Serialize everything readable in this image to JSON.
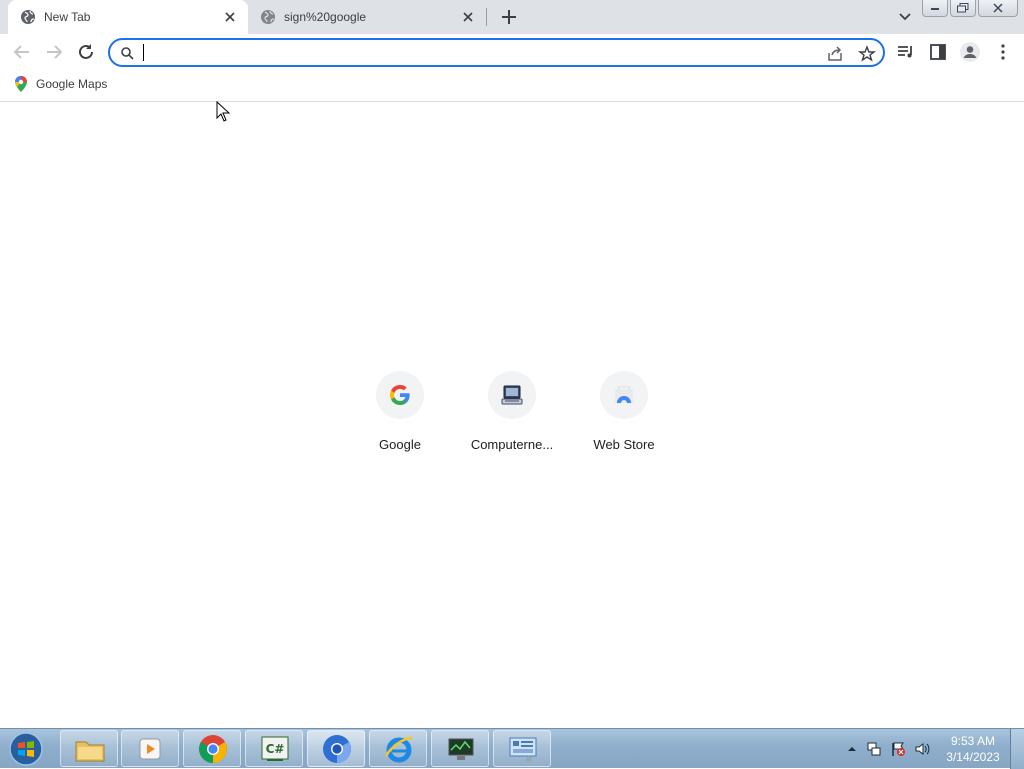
{
  "browser": {
    "tabs": [
      {
        "title": "New Tab",
        "active": true
      },
      {
        "title": "sign%20google",
        "active": false
      }
    ],
    "omnibox": {
      "value": "",
      "placeholder": ""
    },
    "bookmarks": [
      {
        "label": "Google Maps"
      }
    ]
  },
  "newtab": {
    "shortcuts": [
      {
        "label": "Google"
      },
      {
        "label": "Computerne..."
      },
      {
        "label": "Web Store"
      }
    ]
  },
  "taskbar": {
    "apps": [
      {
        "name": "file-explorer-icon"
      },
      {
        "name": "media-player-icon"
      },
      {
        "name": "chrome-icon"
      },
      {
        "name": "csharp-icon"
      },
      {
        "name": "chromium-icon"
      },
      {
        "name": "internet-explorer-icon"
      },
      {
        "name": "monitor-icon"
      },
      {
        "name": "control-panel-icon"
      }
    ],
    "clock": {
      "time": "9:53 AM",
      "date": "3/14/2023"
    }
  },
  "colors": {
    "accent": "#1a73e8",
    "tabstrip": "#dee1e6",
    "taskbar": "#8eaecb"
  }
}
